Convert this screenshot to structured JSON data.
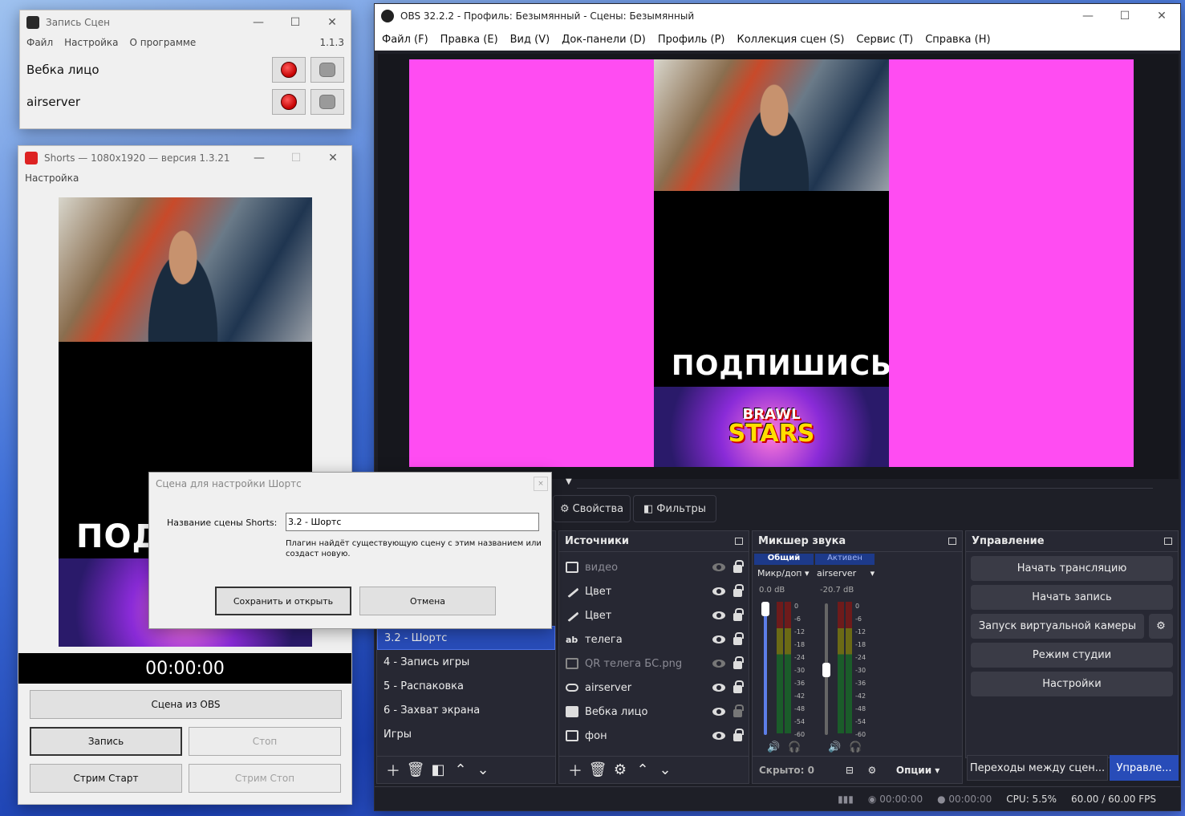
{
  "recorder": {
    "title": "Запись Сцен",
    "menu": [
      "Файл",
      "Настройка",
      "О программе"
    ],
    "version": "1.1.3",
    "rows": [
      {
        "label": "Вебка лицо"
      },
      {
        "label": "airserver"
      }
    ]
  },
  "shorts": {
    "title": "Shorts — 1080x1920 — версия 1.3.21",
    "menu": [
      "Настройка"
    ],
    "timer": "00:00:00",
    "scene_button": "Сцена из OBS",
    "record_button": "Запись",
    "stop_button": "Стоп",
    "stream_start": "Стрим Старт",
    "stream_stop": "Стрим Стоп",
    "overlay_text": "ПОД"
  },
  "dialog": {
    "title": "Сцена для настройки Шортс",
    "label": "Название сцены Shorts:",
    "value": "3.2 - Шортс",
    "hint": "Плагин найдёт существующую сцену с этим названием или создаст новую.",
    "save": "Сохранить и открыть",
    "cancel": "Отмена"
  },
  "obs": {
    "title": "OBS 32.2.2 - Профиль: Безымянный - Сцены: Безымянный",
    "menu": [
      "Файл (F)",
      "Правка (E)",
      "Вид (V)",
      "Док-панели (D)",
      "Профиль (P)",
      "Коллекция сцен (S)",
      "Сервис (T)",
      "Справка (H)"
    ],
    "preview_text": "ПОДПИШИСЬ!",
    "game_logo_1": "BRAWL",
    "game_logo_2": "STARS",
    "properties": "Свойства",
    "filters": "Фильтры",
    "scenes": [
      "3.2 - Шортс",
      "4 - Запись игры",
      "5 - Распаковка",
      "6 - Захват экрана",
      "Игры"
    ],
    "sources_title": "Источники",
    "sources": [
      {
        "name": "видео",
        "visible": false,
        "locked": true,
        "icon": "media-icon"
      },
      {
        "name": "Цвет",
        "visible": true,
        "locked": true,
        "icon": "brush-icon"
      },
      {
        "name": "Цвет",
        "visible": true,
        "locked": true,
        "icon": "brush-icon"
      },
      {
        "name": "телега",
        "visible": true,
        "locked": true,
        "icon": "text-icon"
      },
      {
        "name": "QR телега БС.png",
        "visible": false,
        "locked": true,
        "icon": "image-icon"
      },
      {
        "name": "airserver",
        "visible": true,
        "locked": true,
        "icon": "gamepad-icon"
      },
      {
        "name": "Вебка лицо",
        "visible": true,
        "locked": false,
        "icon": "camera-icon"
      },
      {
        "name": "фон",
        "visible": true,
        "locked": true,
        "icon": "image-icon"
      }
    ],
    "mixer_title": "Микшер звука",
    "mixer": {
      "tab_general": "Общий",
      "tab_active": "Активен",
      "ch1_name": "Микр/доп",
      "ch1_db": "0.0 dB",
      "ch2_name": "airserver",
      "ch2_db": "-20.7 dB",
      "scale": [
        "0",
        "-6",
        "-12",
        "-18",
        "-24",
        "-30",
        "-36",
        "-42",
        "-48",
        "-54",
        "-60"
      ],
      "hidden": "Скрыто: 0",
      "options": "Опции"
    },
    "controls_title": "Управление",
    "controls": [
      "Начать трансляцию",
      "Начать запись",
      "Запуск виртуальной камеры",
      "Режим студии",
      "Настройки"
    ],
    "bottom_tabs": [
      "Переходы между сцен...",
      "Управле..."
    ],
    "status": {
      "stream_time": "00:00:00",
      "rec_time": "00:00:00",
      "cpu": "CPU: 5.5%",
      "fps": "60.00 / 60.00 FPS"
    }
  }
}
